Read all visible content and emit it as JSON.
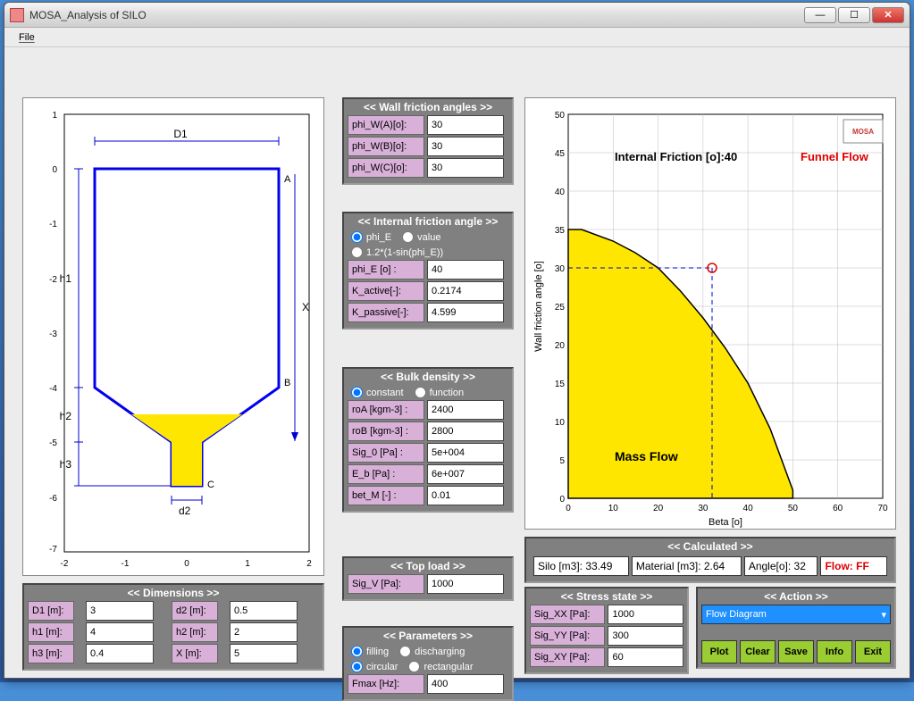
{
  "window": {
    "title": "MOSA_Analysis of SILO"
  },
  "menu": {
    "file": "File"
  },
  "silo_axes": {
    "x_ticks": [
      "-2",
      "-1",
      "0",
      "1",
      "2"
    ],
    "y_ticks": [
      "1",
      "0",
      "-1",
      "-2",
      "-3",
      "-4",
      "-5",
      "-6",
      "-7"
    ],
    "labels": {
      "D1": "D1",
      "h1": "h1",
      "h2": "h2",
      "h3": "h3",
      "d2": "d2",
      "X": "X",
      "A": "A",
      "B": "B",
      "C": "C"
    }
  },
  "dimensions": {
    "title": "<< Dimensions >>",
    "D1": {
      "label": "D1 [m]:",
      "val": "3"
    },
    "d2": {
      "label": "d2 [m]:",
      "val": "0.5"
    },
    "h1": {
      "label": "h1 [m]:",
      "val": "4"
    },
    "h2": {
      "label": "h2 [m]:",
      "val": "2"
    },
    "h3": {
      "label": "h3 [m]:",
      "val": "0.4"
    },
    "X": {
      "label": "X  [m]:",
      "val": "5"
    }
  },
  "wall": {
    "title": "<< Wall friction angles >>",
    "A": {
      "label": "phi_W(A)[o]:",
      "val": "30"
    },
    "B": {
      "label": "phi_W(B)[o]:",
      "val": "30"
    },
    "C": {
      "label": "phi_W(C)[o]:",
      "val": "30"
    }
  },
  "internal": {
    "title": "<< Internal friction angle >>",
    "r1": "phi_E",
    "r2": "value",
    "r3": "1.2*(1-sin(phi_E))",
    "phiE": {
      "label": "phi_E [o]  :",
      "val": "40"
    },
    "kact": {
      "label": "K_active[-]:",
      "val": "0.2174"
    },
    "kpas": {
      "label": "K_passive[-]:",
      "val": "4.599"
    }
  },
  "bulk": {
    "title": "<< Bulk density >>",
    "r1": "constant",
    "r2": "function",
    "roA": {
      "label": "roA [kgm-3] :",
      "val": "2400"
    },
    "roB": {
      "label": "roB [kgm-3] :",
      "val": "2800"
    },
    "sig0": {
      "label": "Sig_0 [Pa] :",
      "val": "5e+004"
    },
    "eb": {
      "label": "E_b [Pa]   :",
      "val": "6e+007"
    },
    "betM": {
      "label": "bet_M [-]  :",
      "val": "0.01"
    }
  },
  "topload": {
    "title": "<< Top load >>",
    "sigV": {
      "label": "Sig_V [Pa]:",
      "val": "1000"
    }
  },
  "params": {
    "title": "<< Parameters >>",
    "r1": "filling",
    "r2": "discharging",
    "r3": "circular",
    "r4": "rectangular",
    "fmax": {
      "label": "Fmax [Hz]:",
      "val": "400"
    }
  },
  "calculated": {
    "title": "<< Calculated >>",
    "silo": "Silo [m3]: 33.49",
    "material": "Material [m3]: 2.64",
    "angle": "Angle[o]: 32",
    "flow": "Flow: FF"
  },
  "stress": {
    "title": "<< Stress state >>",
    "xx": {
      "label": "Sig_XX [Pa]:",
      "val": "1000"
    },
    "yy": {
      "label": "Sig_YY [Pa]:",
      "val": "300"
    },
    "xy": {
      "label": "Sig_XY [Pa]:",
      "val": "60"
    }
  },
  "action": {
    "title": "<< Action >>",
    "select": "Flow Diagram",
    "btns": {
      "plot": "Plot",
      "clear": "Clear",
      "save": "Save",
      "info": "Info",
      "exit": "Exit"
    }
  },
  "chart_data": {
    "type": "area",
    "title_left": "Internal Friction [o]:40",
    "title_right": "Funnel Flow",
    "region_label": "Mass Flow",
    "xlabel": "Beta [o]",
    "ylabel": "Wall friction angle [o]",
    "xlim": [
      0,
      70
    ],
    "ylim": [
      0,
      50
    ],
    "x_ticks": [
      0,
      10,
      20,
      30,
      40,
      50,
      60,
      70
    ],
    "y_ticks": [
      0,
      5,
      10,
      15,
      20,
      25,
      30,
      35,
      40,
      45,
      50
    ],
    "boundary": [
      [
        0,
        35
      ],
      [
        3,
        35
      ],
      [
        10,
        33.5
      ],
      [
        15,
        32
      ],
      [
        20,
        30
      ],
      [
        25,
        27
      ],
      [
        30,
        23.5
      ],
      [
        35,
        19.5
      ],
      [
        40,
        15
      ],
      [
        45,
        9
      ],
      [
        50,
        1
      ]
    ],
    "marker": {
      "x": 32,
      "y": 30
    },
    "logo": "MOSA"
  }
}
